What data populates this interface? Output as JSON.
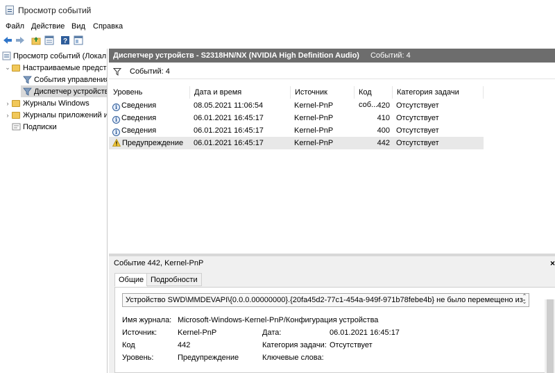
{
  "window": {
    "title": "Просмотр событий"
  },
  "menu": [
    "Файл",
    "Действие",
    "Вид",
    "Справка"
  ],
  "toolbar": {
    "icons": [
      "back-arrow-icon",
      "forward-arrow-icon",
      "folder-up-icon",
      "properties-icon",
      "help-icon",
      "show-hide-pane-icon"
    ]
  },
  "tree": {
    "root": "Просмотр событий (Локал",
    "custom_views": "Настраиваемые предста",
    "admin_events": "События управления",
    "device_manager": "Диспетчер устройств",
    "windows_logs": "Журналы Windows",
    "app_logs": "Журналы приложений и",
    "subscriptions": "Подписки"
  },
  "header": {
    "title": "Диспетчер устройств - S2318HN/NX (NVIDIA High Definition Audio)",
    "count": "Событий: 4"
  },
  "filter": {
    "count": "Событий: 4"
  },
  "table": {
    "columns": [
      "Уровень",
      "Дата и время",
      "Источник",
      "Код соб...",
      "Категория задачи"
    ],
    "rows": [
      {
        "level": "Сведения",
        "icon": "info-icon",
        "datetime": "08.05.2021 11:06:54",
        "source": "Kernel-PnP",
        "code": "420",
        "category": "Отсутствует"
      },
      {
        "level": "Сведения",
        "icon": "info-icon",
        "datetime": "06.01.2021 16:45:17",
        "source": "Kernel-PnP",
        "code": "410",
        "category": "Отсутствует"
      },
      {
        "level": "Сведения",
        "icon": "info-icon",
        "datetime": "06.01.2021 16:45:17",
        "source": "Kernel-PnP",
        "code": "400",
        "category": "Отсутствует"
      },
      {
        "level": "Предупреждение",
        "icon": "warning-icon",
        "datetime": "06.01.2021 16:45:17",
        "source": "Kernel-PnP",
        "code": "442",
        "category": "Отсутствует"
      }
    ]
  },
  "detail": {
    "title": "Событие 442, Kernel-PnP",
    "close": "×",
    "tabs": [
      "Общие",
      "Подробности"
    ],
    "description": "Устройство SWD\\MMDEVAPI\\{0.0.0.00000000}.{20fa45d2-77c1-454a-949f-971b78febe4b} не было перемещено из-",
    "labels": {
      "log_name": "Имя журнала:",
      "source": "Источник:",
      "code": "Код",
      "level": "Уровень:",
      "date": "Дата:",
      "task_category": "Категория задачи:",
      "keywords": "Ключевые слова:"
    },
    "values": {
      "log_name": "Microsoft-Windows-Kernel-PnP/Конфигурация устройства",
      "source": "Kernel-PnP",
      "code": "442",
      "level": "Предупреждение",
      "date": "06.01.2021 16:45:17",
      "task_category": "Отсутствует"
    }
  }
}
